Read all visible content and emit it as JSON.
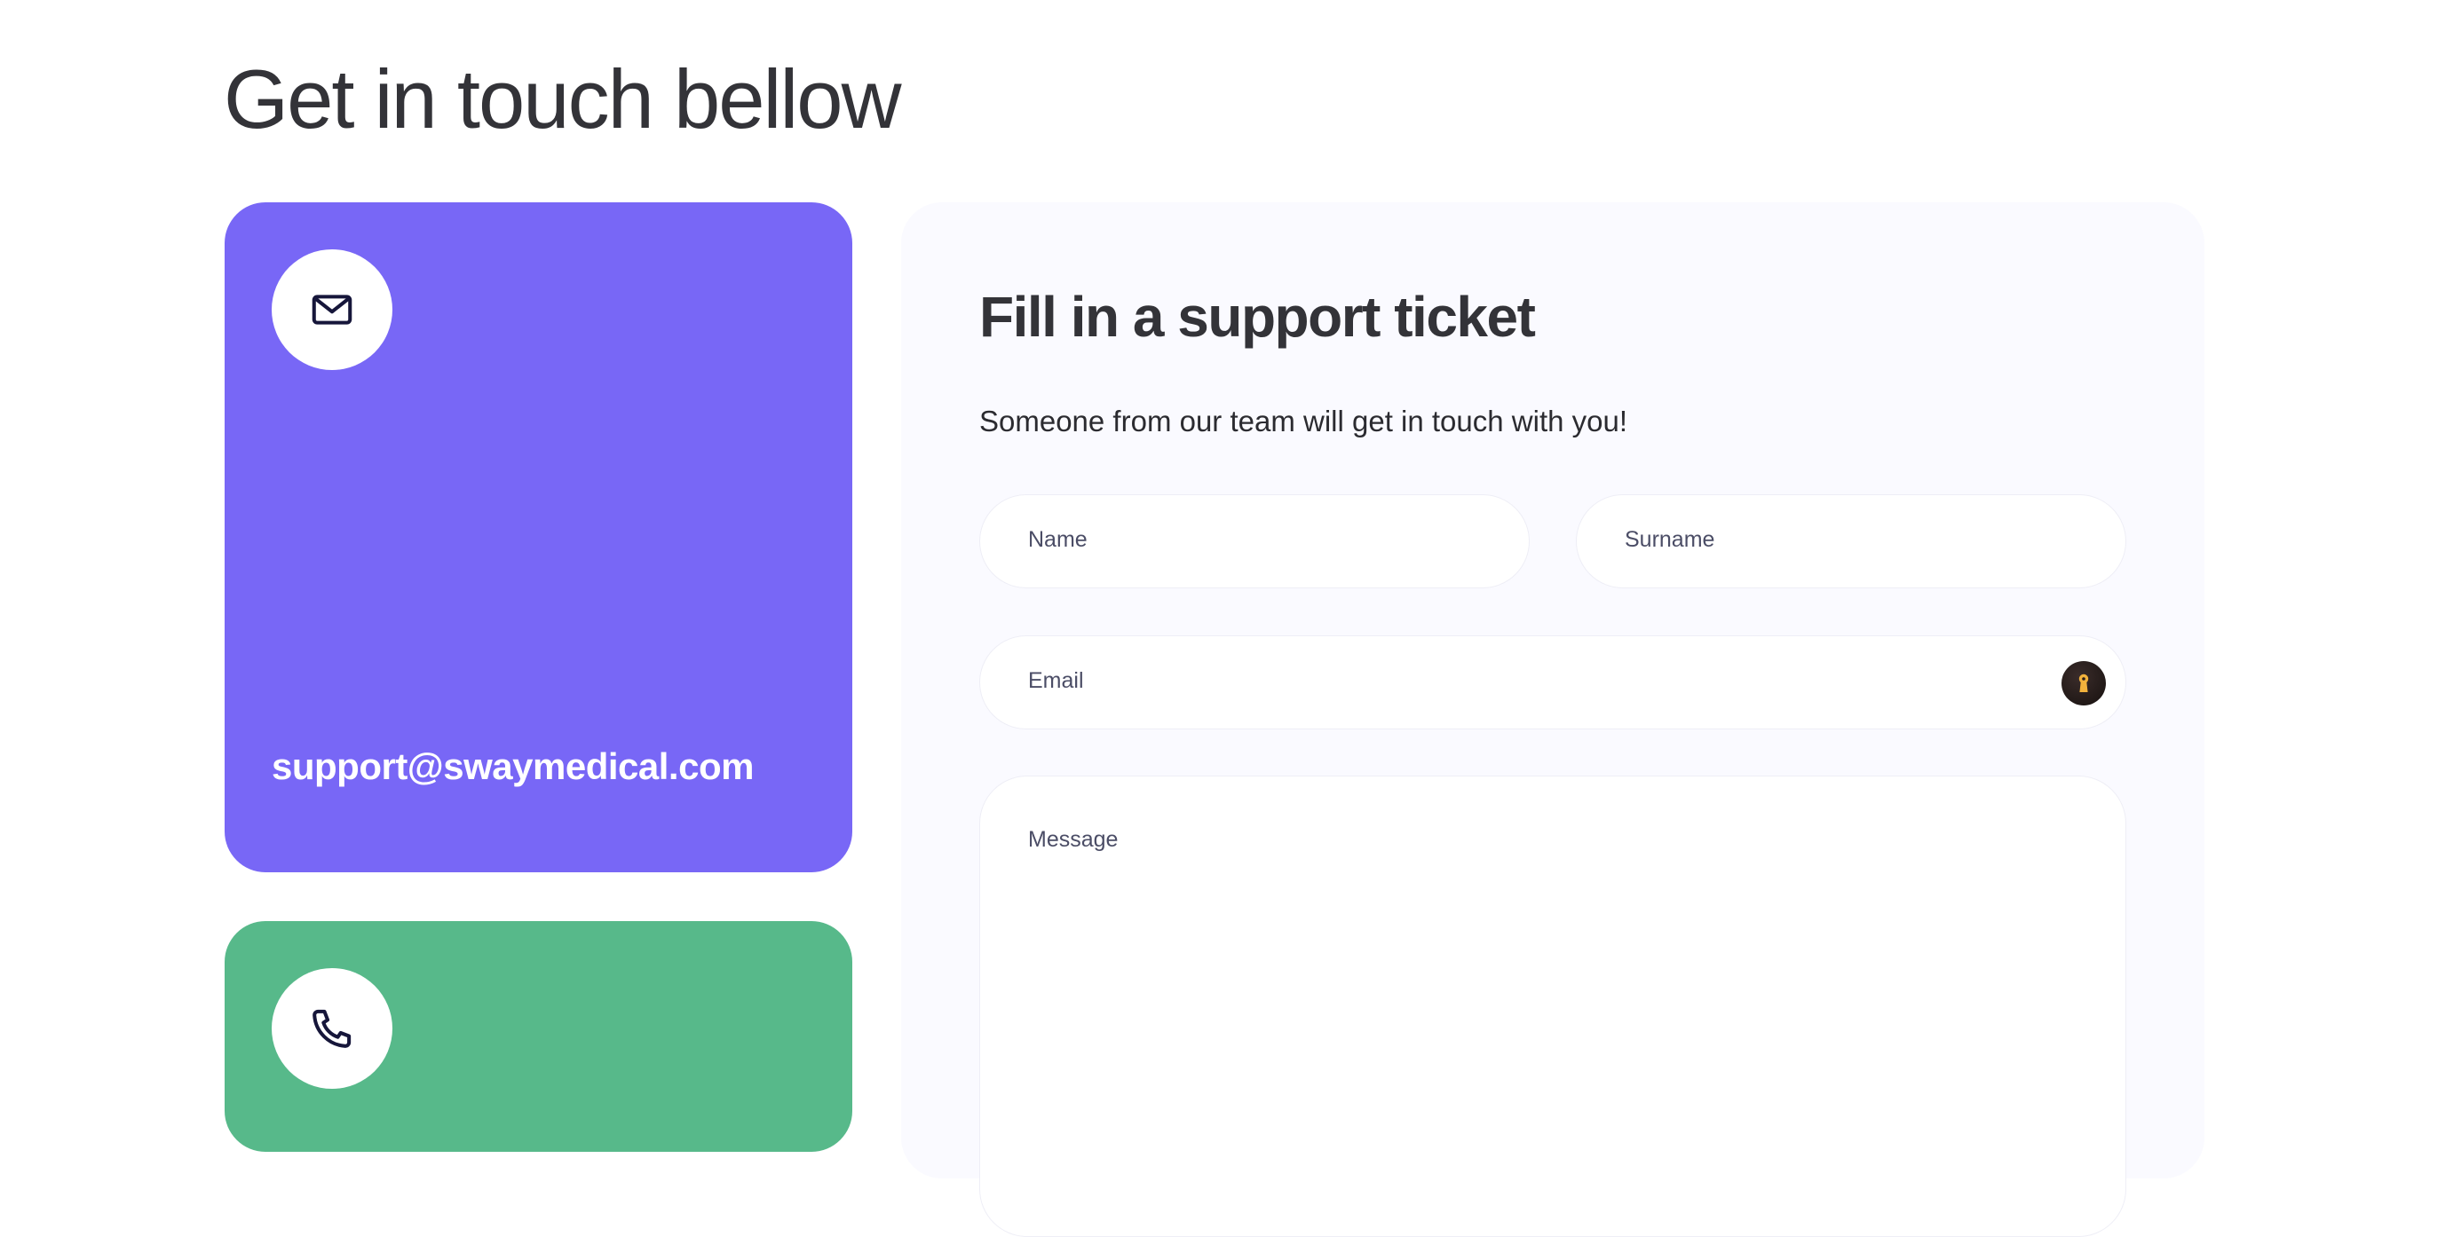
{
  "page": {
    "title": "Get in touch bellow"
  },
  "contact_cards": {
    "email": {
      "icon": "mail-icon",
      "text": "support@swaymedical.com",
      "color": "#7867f6"
    },
    "phone": {
      "icon": "phone-icon",
      "color": "#57b98a"
    }
  },
  "support_form": {
    "title": "Fill in a support ticket",
    "subtitle": "Someone from our team will get in touch with you!",
    "fields": {
      "name": {
        "label": "Name"
      },
      "surname": {
        "label": "Surname"
      },
      "email": {
        "label": "Email",
        "trailing_icon": "password-manager-key-icon"
      },
      "message": {
        "label": "Message"
      }
    }
  }
}
